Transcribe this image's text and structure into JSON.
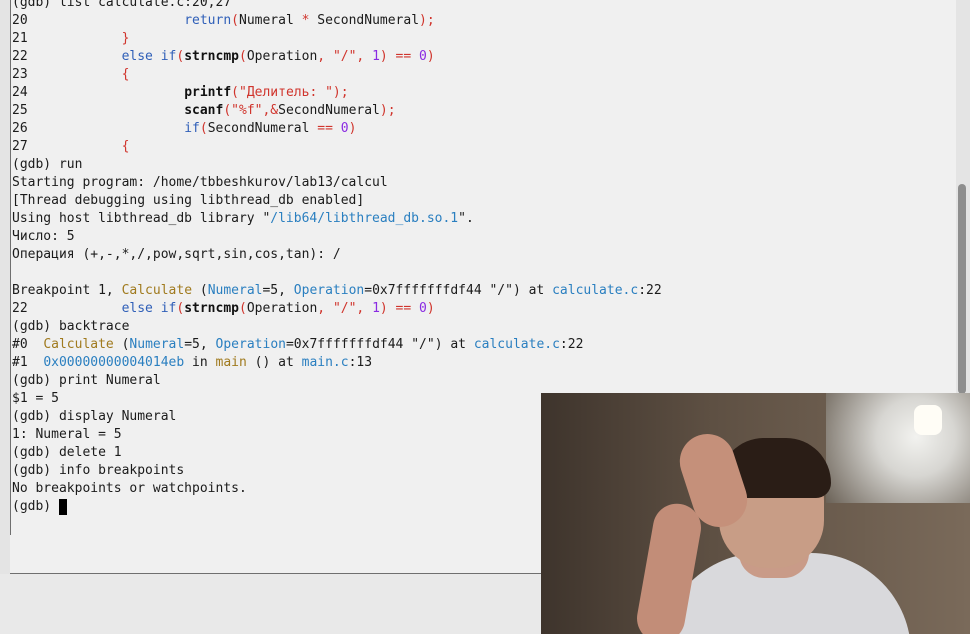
{
  "terminal": {
    "line1": "(gdb) list calculate.c:20,27",
    "l20": {
      "no": "20",
      "t1": "return",
      "t2": "(",
      "t3": "Numeral ",
      "t4": "*",
      "t5": " SecondNumeral",
      "t6": ");"
    },
    "l21": {
      "no": "21",
      "t1": "}"
    },
    "l22": {
      "no": "22",
      "t1": "else if",
      "t2": "(",
      "t3": "strncmp",
      "t4": "(",
      "t5": "Operation",
      "t6": ", ",
      "t7": "\"/\"",
      "t8": ", ",
      "t9": "1",
      "t10": ") == ",
      "t11": "0",
      "t12": ")"
    },
    "l23": {
      "no": "23",
      "t1": "{"
    },
    "l24": {
      "no": "24",
      "t1": "printf",
      "t2": "(",
      "t3": "\"Делитель: \"",
      "t4": ");"
    },
    "l25": {
      "no": "25",
      "t1": "scanf",
      "t2": "(",
      "t3": "\"%f\"",
      "t4": ",&",
      "t5": "SecondNumeral",
      "t6": ");"
    },
    "l26": {
      "no": "26",
      "t1": "if",
      "t2": "(",
      "t3": "SecondNumeral ",
      "t4": "==",
      "t5": " 0",
      "t6": ")"
    },
    "l27": {
      "no": "27",
      "t1": "{"
    },
    "run": "(gdb) run",
    "starting": "Starting program: /home/tbbeshkurov/lab13/calcul",
    "thread": "[Thread debugging using libthread_db enabled]",
    "using_a": "Using host libthread_db library \"",
    "using_b": "/lib64/libthread_db.so.1",
    "using_c": "\".",
    "chislo": "Число: 5",
    "operaciya": "Операция (+,-,*,/,pow,sqrt,sin,cos,tan): /",
    "bp_a": "Breakpoint 1, ",
    "bp_func": "Calculate",
    "bp_b": " (",
    "bp_var1": "Numeral",
    "bp_c": "=5, ",
    "bp_var2": "Operation",
    "bp_d": "=0x7fffffffdf44 \"/\") at ",
    "bp_file": "calculate.c",
    "bp_e": ":22",
    "l22b": {
      "no": "22",
      "t1": "else if",
      "t2": "(",
      "t3": "strncmp",
      "t4": "(",
      "t5": "Operation",
      "t6": ", ",
      "t7": "\"/\"",
      "t8": ", ",
      "t9": "1",
      "t10": ") == ",
      "t11": "0",
      "t12": ")"
    },
    "backtrace": "(gdb) backtrace",
    "f0_a": "#0  ",
    "f0_func": "Calculate",
    "f0_b": " (",
    "f0_var1": "Numeral",
    "f0_c": "=5, ",
    "f0_var2": "Operation",
    "f0_d": "=0x7fffffffdf44 \"/\") at ",
    "f0_file": "calculate.c",
    "f0_e": ":22",
    "f1_a": "#1  ",
    "f1_addr": "0x00000000004014eb",
    "f1_b": " in ",
    "f1_func": "main",
    "f1_c": " () at ",
    "f1_file": "main.c",
    "f1_d": ":13",
    "print": "(gdb) print Numeral",
    "print_res": "$1 = 5",
    "display": "(gdb) display Numeral",
    "display_res": "1: Numeral = 5",
    "delete": "(gdb) delete 1",
    "info": "(gdb) info breakpoints",
    "info_res": "No breakpoints or watchpoints.",
    "prompt": "(gdb) "
  },
  "colors": {
    "keyword": "#2f5fb8",
    "string": "#d0342c",
    "number": "#8a2be2",
    "func": "#a07a1e",
    "var": "#2a7fc0"
  }
}
